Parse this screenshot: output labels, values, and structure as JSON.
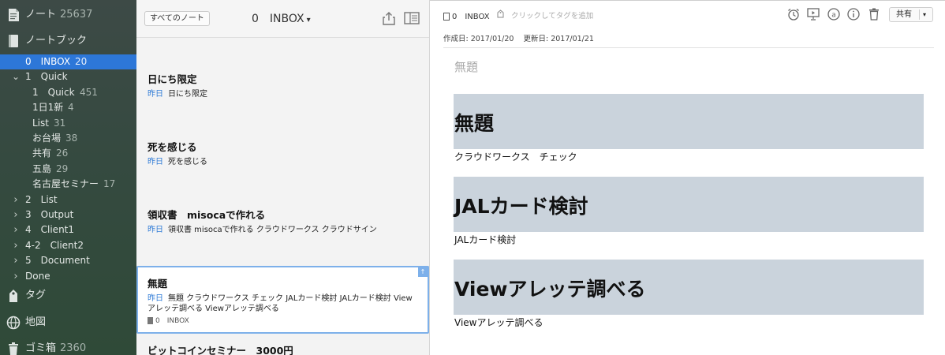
{
  "sidebar": {
    "notes": {
      "label": "ノート",
      "count": "25637"
    },
    "notebooks": {
      "label": "ノートブック"
    },
    "items": [
      {
        "label": "0　INBOX",
        "count": "20",
        "level": 1,
        "chev": "",
        "selected": true
      },
      {
        "label": "1　Quick",
        "count": "",
        "level": 1,
        "chev": "down"
      },
      {
        "label": "1　Quick",
        "count": "451",
        "level": 2,
        "chev": ""
      },
      {
        "label": "1日1新",
        "count": "4",
        "level": 2,
        "chev": ""
      },
      {
        "label": "List",
        "count": "31",
        "level": 2,
        "chev": ""
      },
      {
        "label": "お台場",
        "count": "38",
        "level": 2,
        "chev": ""
      },
      {
        "label": "共有",
        "count": "26",
        "level": 2,
        "chev": ""
      },
      {
        "label": "五島",
        "count": "29",
        "level": 2,
        "chev": ""
      },
      {
        "label": "名古屋セミナー",
        "count": "17",
        "level": 2,
        "chev": ""
      },
      {
        "label": "2　List",
        "count": "",
        "level": 1,
        "chev": "right"
      },
      {
        "label": "3　Output",
        "count": "",
        "level": 1,
        "chev": "right"
      },
      {
        "label": "4　Client1",
        "count": "",
        "level": 1,
        "chev": "right"
      },
      {
        "label": "4-2　Client2",
        "count": "",
        "level": 1,
        "chev": "right"
      },
      {
        "label": "5　Document",
        "count": "",
        "level": 1,
        "chev": "right"
      },
      {
        "label": "Done",
        "count": "",
        "level": 1,
        "chev": "right"
      }
    ],
    "tags": {
      "label": "タグ"
    },
    "map": {
      "label": "地図"
    },
    "trash": {
      "label": "ゴミ箱",
      "count": "2360"
    }
  },
  "list": {
    "all_notes_label": "すべてのノート",
    "notebook_title": "0　INBOX",
    "notes": [
      {
        "title": "日にち限定",
        "date": "昨日",
        "snippet": "日にち限定"
      },
      {
        "title": "死を感じる",
        "date": "昨日",
        "snippet": "死を感じる"
      },
      {
        "title": "領収書　misocaで作れる",
        "date": "昨日",
        "snippet": "領収書 misocaで作れる クラウドワークス クラウドサイン"
      },
      {
        "title": "無題",
        "date": "昨日",
        "snippet": "無題 クラウドワークス チェック JALカード検討 JALカード検討 Viewアレッテ調べる Viewアレッテ調べる",
        "meta": "0　INBOX",
        "selected": true
      },
      {
        "title": "ビットコインセミナー　3000円"
      }
    ]
  },
  "editor": {
    "notebook_label": "0　INBOX",
    "tag_placeholder": "クリックしてタグを追加",
    "share_label": "共有",
    "created": "作成日: 2017/01/20",
    "updated": "更新日: 2017/01/21",
    "title": "無題",
    "sections": [
      {
        "heading": "無題",
        "body": "クラウドワークス　チェック"
      },
      {
        "heading": "JALカード検討",
        "body": "JALカード検討"
      },
      {
        "heading": "Viewアレッテ調べる",
        "body": "Viewアレッテ調べる"
      }
    ]
  }
}
